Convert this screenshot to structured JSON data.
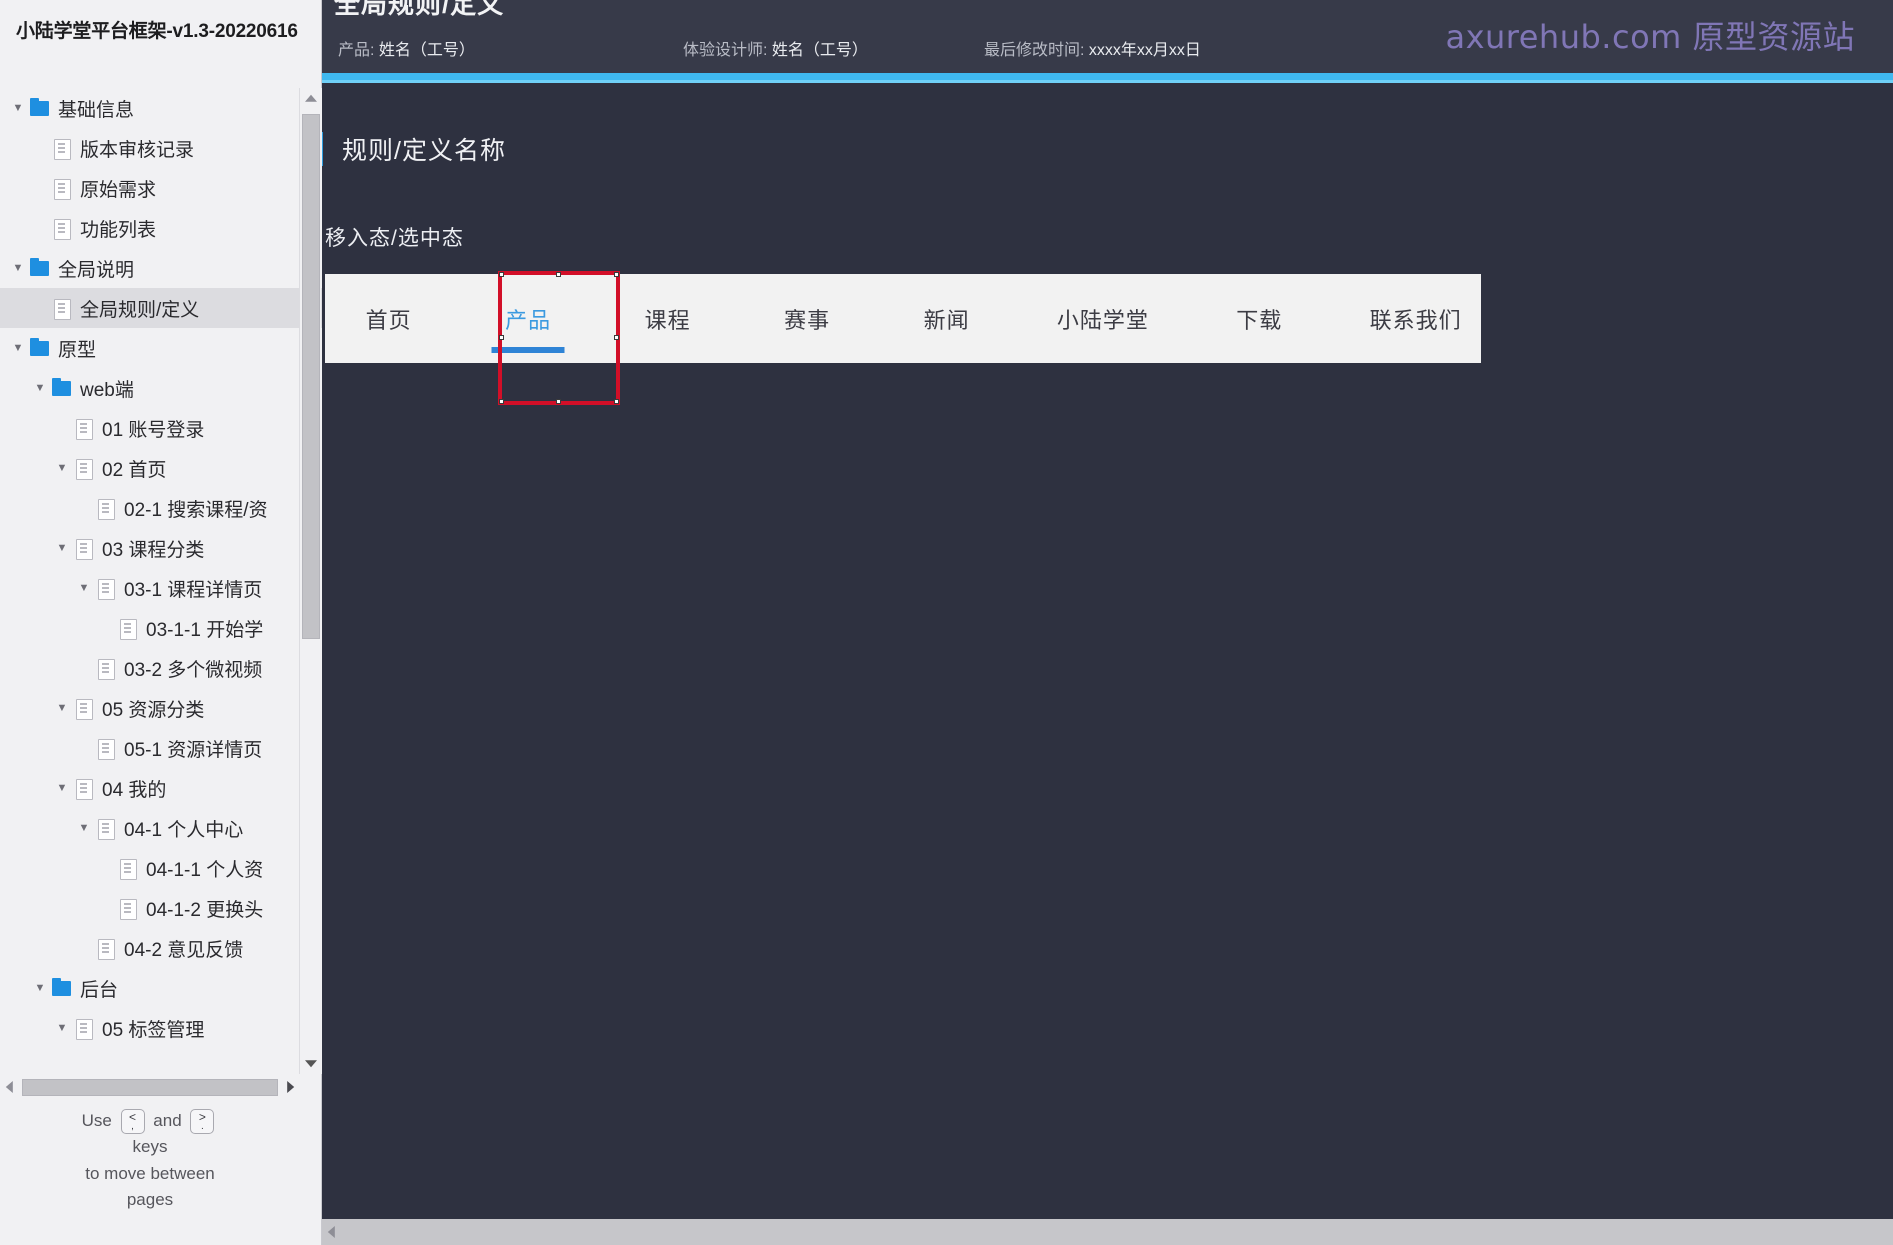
{
  "sidebar": {
    "project_title": "小陆学堂平台框架-v1.3-20220616",
    "tree": [
      {
        "label": "基础信息",
        "depth": 0,
        "icon": "folder-icon",
        "twist": "▼",
        "selected": false
      },
      {
        "label": "版本审核记录",
        "depth": 1,
        "icon": "page-icon",
        "twist": "",
        "selected": false
      },
      {
        "label": "原始需求",
        "depth": 1,
        "icon": "page-icon",
        "twist": "",
        "selected": false
      },
      {
        "label": "功能列表",
        "depth": 1,
        "icon": "page-icon",
        "twist": "",
        "selected": false
      },
      {
        "label": "全局说明",
        "depth": 0,
        "icon": "folder-icon",
        "twist": "▼",
        "selected": false
      },
      {
        "label": "全局规则/定义",
        "depth": 1,
        "icon": "page-icon",
        "twist": "",
        "selected": true
      },
      {
        "label": "原型",
        "depth": 0,
        "icon": "folder-icon",
        "twist": "▼",
        "selected": false
      },
      {
        "label": "web端",
        "depth": 1,
        "icon": "folder-icon",
        "twist": "▼",
        "selected": false
      },
      {
        "label": "01 账号登录",
        "depth": 2,
        "icon": "page-icon",
        "twist": "",
        "selected": false
      },
      {
        "label": "02 首页",
        "depth": 2,
        "icon": "page-icon",
        "twist": "▼",
        "selected": false
      },
      {
        "label": "02-1 搜索课程/资",
        "depth": 3,
        "icon": "page-icon",
        "twist": "",
        "selected": false
      },
      {
        "label": "03 课程分类",
        "depth": 2,
        "icon": "page-icon",
        "twist": "▼",
        "selected": false
      },
      {
        "label": "03-1 课程详情页",
        "depth": 3,
        "icon": "page-icon",
        "twist": "▼",
        "selected": false
      },
      {
        "label": "03-1-1 开始学",
        "depth": 4,
        "icon": "page-icon",
        "twist": "",
        "selected": false
      },
      {
        "label": "03-2 多个微视频",
        "depth": 3,
        "icon": "page-icon",
        "twist": "",
        "selected": false
      },
      {
        "label": "05 资源分类",
        "depth": 2,
        "icon": "page-icon",
        "twist": "▼",
        "selected": false
      },
      {
        "label": "05-1 资源详情页",
        "depth": 3,
        "icon": "page-icon",
        "twist": "",
        "selected": false
      },
      {
        "label": "04 我的",
        "depth": 2,
        "icon": "page-icon",
        "twist": "▼",
        "selected": false
      },
      {
        "label": "04-1 个人中心",
        "depth": 3,
        "icon": "page-icon",
        "twist": "▼",
        "selected": false
      },
      {
        "label": "04-1-1 个人资",
        "depth": 4,
        "icon": "page-icon",
        "twist": "",
        "selected": false
      },
      {
        "label": "04-1-2 更换头",
        "depth": 4,
        "icon": "page-icon",
        "twist": "",
        "selected": false
      },
      {
        "label": "04-2 意见反馈",
        "depth": 3,
        "icon": "page-icon",
        "twist": "",
        "selected": false
      },
      {
        "label": "后台",
        "depth": 1,
        "icon": "folder-icon",
        "twist": "▼",
        "selected": false
      },
      {
        "label": "05 标签管理",
        "depth": 2,
        "icon": "page-icon",
        "twist": "▼",
        "selected": false
      }
    ],
    "hint": {
      "use": "Use",
      "key_prev": "<",
      "key_prev_sub": ",",
      "and": "and",
      "key_next": ">",
      "key_next_sub": ".",
      "line2": "keys",
      "line3": "to move between",
      "line4": "pages"
    }
  },
  "header": {
    "doc_title": "全局规则/定义",
    "meta": [
      {
        "key": "产品:",
        "value": "姓名（工号）"
      },
      {
        "key": "体验设计师:",
        "value": "姓名（工号）"
      },
      {
        "key": "最后修改时间:",
        "value": "xxxx年xx月xx日"
      }
    ],
    "watermark": "axurehub.com 原型资源站"
  },
  "main": {
    "section_title": "规则/定义名称",
    "state_label": "移入态/选中态",
    "navbar": {
      "items": [
        {
          "label": "首页",
          "active": false,
          "wide": false
        },
        {
          "label": "产品",
          "active": true,
          "wide": false
        },
        {
          "label": "课程",
          "active": false,
          "wide": false
        },
        {
          "label": "赛事",
          "active": false,
          "wide": false
        },
        {
          "label": "新闻",
          "active": false,
          "wide": false
        },
        {
          "label": "小陆学堂",
          "active": false,
          "wide": true
        },
        {
          "label": "下载",
          "active": false,
          "wide": false
        },
        {
          "label": "联系我们",
          "active": false,
          "wide": true
        }
      ]
    }
  },
  "colors": {
    "canvas_bg": "#2e3140",
    "header_bg": "#373a49",
    "accent_rule": "#3fb8ef",
    "nav_active": "#3b9ae0",
    "nav_underline": "#2f84d6",
    "annotation": "#d20f28",
    "folder": "#1e8fe0",
    "watermark": "#9d8ee0"
  }
}
